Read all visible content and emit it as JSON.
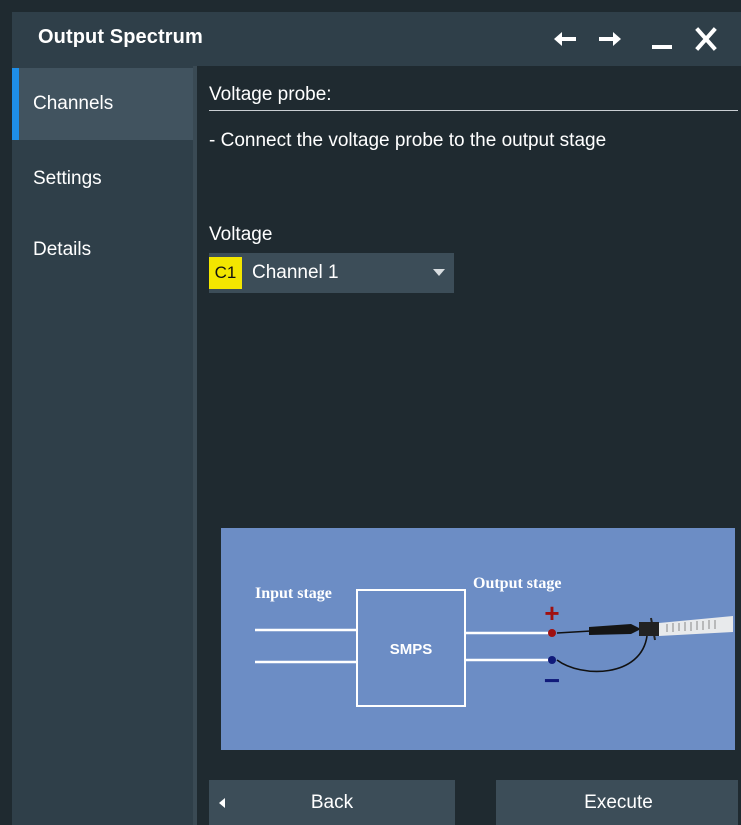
{
  "window": {
    "title": "Output Spectrum",
    "buttons": [
      "back-arrow",
      "forward-arrow",
      "minimize",
      "close"
    ]
  },
  "sidebar": {
    "items": [
      {
        "label": "Channels",
        "active": true
      },
      {
        "label": "Settings",
        "active": false
      },
      {
        "label": "Details",
        "active": false
      }
    ]
  },
  "main": {
    "section_label": "Voltage probe:",
    "instruction": "- Connect the voltage probe to the output stage",
    "voltage_label": "Voltage",
    "channel": {
      "badge": "C1",
      "name": "Channel 1",
      "badge_color": "#f3e600"
    }
  },
  "diagram": {
    "input_label": "Input stage",
    "output_label": "Output stage",
    "box_label": "SMPS",
    "plus": "+",
    "minus": "−"
  },
  "footer": {
    "back_label": "Back",
    "execute_label": "Execute"
  },
  "colors": {
    "accent": "#1e8ee8",
    "diagram_bg": "#6c8dc5",
    "plus": "#a01010",
    "minus": "#101a7a"
  }
}
